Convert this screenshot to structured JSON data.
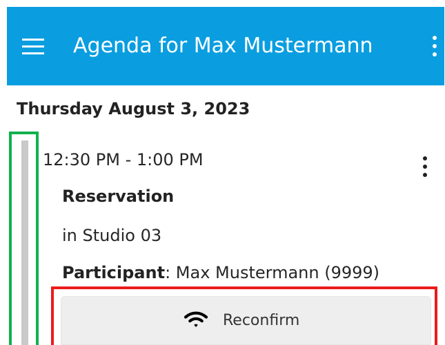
{
  "header": {
    "title": "Agenda for Max Mustermann",
    "menu_icon": "hamburger-menu-icon",
    "more_icon": "vertical-more-icon",
    "background_color": "#0a9ee0"
  },
  "agenda": {
    "date_heading": "Thursday August 3, 2023",
    "items": [
      {
        "time_range": "12:30 PM - 1:00 PM",
        "title": "Reservation",
        "location": "in Studio 03",
        "participant_label": "Participant",
        "participant_separator": ":",
        "participant_value": " Max Mustermann (9999)",
        "menu_icon": "vertical-more-icon",
        "action": {
          "label": "Reconfirm",
          "icon": "wifi-icon"
        }
      }
    ]
  },
  "annotations": {
    "green_frame_color": "#10b14d",
    "red_frame_color": "#ec1b1b"
  }
}
